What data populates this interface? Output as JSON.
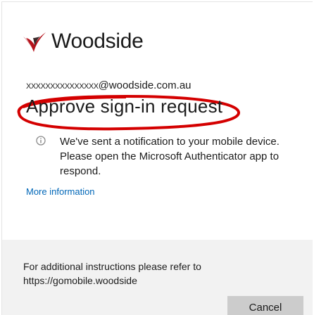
{
  "brand": {
    "logo_icon": "woodside-logo-icon",
    "name": "Woodside",
    "accent_color": "#b5121b"
  },
  "account": {
    "redacted_prefix": "XXXXXXXXXXXXXXX",
    "domain": "@woodside.com.au"
  },
  "page": {
    "title": "Approve sign-in request",
    "annotation_color": "#d40000"
  },
  "message": {
    "icon": "info-icon",
    "text": "We've sent a notification to your mobile device. Please open the Microsoft Authenticator app to respond."
  },
  "links": {
    "more_information": "More information",
    "link_color": "#0067b8"
  },
  "footer": {
    "line1": "For additional instructions please refer to",
    "line2": "https://gomobile.woodside",
    "cancel_label": "Cancel"
  }
}
